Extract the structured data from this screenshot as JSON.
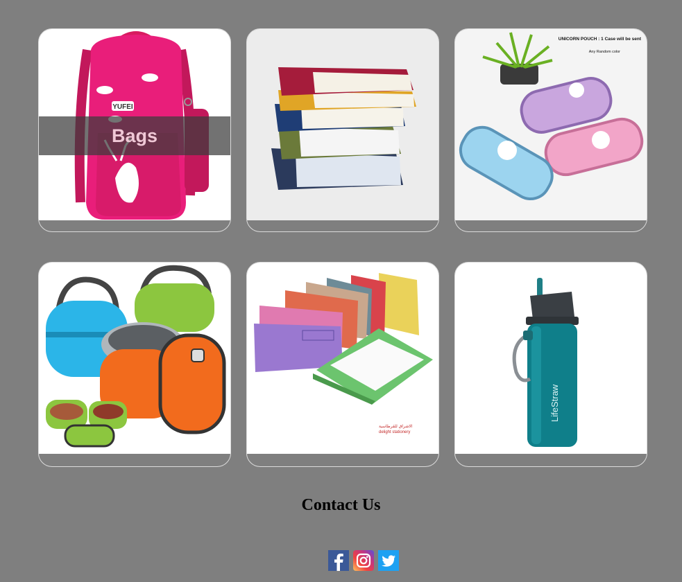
{
  "categories": [
    {
      "label": "Bags",
      "image": "pink-backpack-image",
      "show_label": true
    },
    {
      "label": "",
      "image": "book-stack-image",
      "show_label": false
    },
    {
      "label": "",
      "image": "unicorn-pencil-cases-image",
      "show_label": false
    },
    {
      "label": "",
      "image": "lunch-boxes-image",
      "show_label": false
    },
    {
      "label": "",
      "image": "document-folders-image",
      "show_label": false
    },
    {
      "label": "",
      "image": "water-bottle-image",
      "show_label": false
    }
  ],
  "image_text": {
    "backpack_brand": "YUFEI",
    "pouch_title": "UNICORN POUCH : 1 Case will be sent",
    "pouch_sub": "Any Random color",
    "folders_brand_ar": "الاشراق للقرطاسية",
    "folders_brand_en": "delight stationery",
    "bottle_brand": "LifeStraw"
  },
  "contact": {
    "title": "Contact Us",
    "social": [
      {
        "name": "facebook-icon",
        "color": "#3b5998"
      },
      {
        "name": "instagram-icon",
        "color": "#c13584"
      },
      {
        "name": "twitter-icon",
        "color": "#1da1f2"
      }
    ]
  },
  "colors": {
    "page_bg": "#7f7f7f",
    "overlay_text": "#f0c8d6"
  }
}
